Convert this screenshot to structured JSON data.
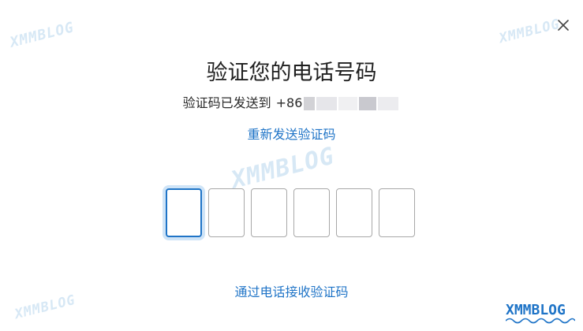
{
  "dialog": {
    "title": "验证您的电话号码",
    "subtitle_prefix": "验证码已发送到",
    "phone_prefix": "+86",
    "resend_label": "重新发送验证码",
    "phone_call_label": "通过电话接收验证码",
    "code_length": 6,
    "active_box_index": 0
  },
  "watermark": {
    "text": "XMMBLOG"
  },
  "colors": {
    "accent": "#1f74c7",
    "accent_focus_ring": "#cfe4f7",
    "box_border": "#a8a8a8",
    "title_text": "#1f1f1f"
  }
}
